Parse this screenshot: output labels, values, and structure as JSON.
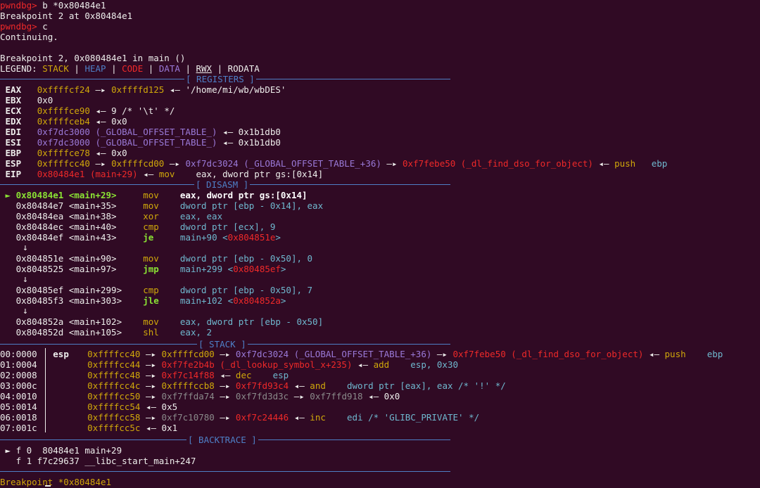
{
  "lines": {
    "l1": {
      "prompt": "pwndbg>",
      "cmd": " b *0x80484e1"
    },
    "l2": "Breakpoint 2 at 0x80484e1",
    "l3": {
      "prompt": "pwndbg>",
      "cmd": " c"
    },
    "l4": "Continuing.",
    "l5": "Breakpoint 2, 0x080484e1 in main ()",
    "legend": {
      "label": "LEGEND: ",
      "stack": "STACK",
      "heap": "HEAP",
      "code": "CODE",
      "data": "DATA",
      "rwx": "RWX",
      "rodata": "RODATA",
      "sep": " | "
    }
  },
  "headers": {
    "registers": "[ REGISTERS ]",
    "disasm": "[ DISASM ]",
    "stack": "[ STACK ]",
    "backtrace": "[ BACKTRACE ]"
  },
  "registers": [
    {
      "name": "EAX",
      "parts": [
        {
          "t": "0xffffcf24",
          "c": "yellow"
        },
        {
          "t": " —▸ ",
          "c": "white"
        },
        {
          "t": "0xffffd125",
          "c": "yellow"
        },
        {
          "t": " ◂— '/home/mi/wb/wbDES'",
          "c": "white"
        }
      ]
    },
    {
      "name": "EBX",
      "parts": [
        {
          "t": "0x0",
          "c": "white"
        }
      ]
    },
    {
      "name": "ECX",
      "parts": [
        {
          "t": "0xffffce90",
          "c": "yellow"
        },
        {
          "t": " ◂— 9 /* '\\t' */",
          "c": "white"
        }
      ]
    },
    {
      "name": "EDX",
      "parts": [
        {
          "t": "0xffffceb4",
          "c": "yellow"
        },
        {
          "t": " ◂— 0x0",
          "c": "white"
        }
      ]
    },
    {
      "name": "EDI",
      "parts": [
        {
          "t": "0xf7dc3000 (_GLOBAL_OFFSET_TABLE_)",
          "c": "purple"
        },
        {
          "t": " ◂— 0x1b1db0",
          "c": "white"
        }
      ]
    },
    {
      "name": "ESI",
      "parts": [
        {
          "t": "0xf7dc3000 (_GLOBAL_OFFSET_TABLE_)",
          "c": "purple"
        },
        {
          "t": " ◂— 0x1b1db0",
          "c": "white"
        }
      ]
    },
    {
      "name": "EBP",
      "parts": [
        {
          "t": "0xffffce78",
          "c": "yellow"
        },
        {
          "t": " ◂— 0x0",
          "c": "white"
        }
      ]
    },
    {
      "name": "ESP",
      "parts": [
        {
          "t": "0xffffcc40",
          "c": "yellow"
        },
        {
          "t": " —▸ ",
          "c": "white"
        },
        {
          "t": "0xffffcd00",
          "c": "yellow"
        },
        {
          "t": " —▸ ",
          "c": "white"
        },
        {
          "t": "0xf7dc3024 (_GLOBAL_OFFSET_TABLE_+36)",
          "c": "purple"
        },
        {
          "t": " —▸ ",
          "c": "white"
        },
        {
          "t": "0xf7febe50 (_dl_find_dso_for_object)",
          "c": "red"
        },
        {
          "t": " ◂— ",
          "c": "white"
        },
        {
          "t": "push",
          "c": "yellow"
        },
        {
          "t": "   ",
          "c": "white"
        },
        {
          "t": "ebp",
          "c": "cyan"
        }
      ]
    },
    {
      "name": "EIP",
      "parts": [
        {
          "t": "0x80484e1 (main+29)",
          "c": "red"
        },
        {
          "t": " ◂— ",
          "c": "white"
        },
        {
          "t": "mov",
          "c": "yellow"
        },
        {
          "t": "    eax, dword ptr gs:[0x14]",
          "c": "white"
        }
      ]
    }
  ],
  "disasm": [
    {
      "cur": true,
      "addr": "0x80484e1",
      "sym": "<main+29>",
      "op": "mov",
      "args": "eax, dword ptr gs:[0x14]"
    },
    {
      "addr": "0x80484e7",
      "sym": "<main+35>",
      "op": "mov",
      "args": "dword ptr [ebp - 0x14], eax"
    },
    {
      "addr": "0x80484ea",
      "sym": "<main+38>",
      "op": "xor",
      "args": "eax, eax"
    },
    {
      "addr": "0x80484ec",
      "sym": "<main+40>",
      "op": "cmp",
      "args": "dword ptr [ecx], 9"
    },
    {
      "addr": "0x80484ef",
      "sym": "<main+43>",
      "op": "je",
      "jmp": true,
      "args": "main+90",
      "target": "0x804851e"
    },
    {
      "addr": "0x804851e",
      "sym": "<main+90>",
      "op": "mov",
      "args": "dword ptr [ebp - 0x50], 0"
    },
    {
      "addr": "0x8048525",
      "sym": "<main+97>",
      "op": "jmp",
      "jmp": true,
      "args": "main+299",
      "target": "0x80485ef"
    },
    {
      "addr": "0x80485ef",
      "sym": "<main+299>",
      "op": "cmp",
      "args": "dword ptr [ebp - 0x50], 7"
    },
    {
      "addr": "0x80485f3",
      "sym": "<main+303>",
      "op": "jle",
      "jmp": true,
      "args": "main+102",
      "target": "0x804852a"
    },
    {
      "addr": "0x804852a",
      "sym": "<main+102>",
      "op": "mov",
      "args": "eax, dword ptr [ebp - 0x50]"
    },
    {
      "addr": "0x804852d",
      "sym": "<main+105>",
      "op": "shl",
      "args": "eax, 2"
    }
  ],
  "stack": [
    {
      "off": "00:0000",
      "reg": "esp",
      "parts": [
        {
          "t": "0xffffcc40",
          "c": "yellow"
        },
        {
          "t": " —▸ ",
          "c": "white"
        },
        {
          "t": "0xffffcd00",
          "c": "yellow"
        },
        {
          "t": " —▸ ",
          "c": "white"
        },
        {
          "t": "0xf7dc3024 (_GLOBAL_OFFSET_TABLE_+36)",
          "c": "purple"
        },
        {
          "t": " —▸ ",
          "c": "white"
        },
        {
          "t": "0xf7febe50 (_dl_find_dso_for_object)",
          "c": "red"
        },
        {
          "t": " ◂— ",
          "c": "white"
        },
        {
          "t": "push",
          "c": "yellow"
        },
        {
          "t": "    ",
          "c": "white"
        },
        {
          "t": "ebp",
          "c": "cyan"
        }
      ]
    },
    {
      "off": "01:0004",
      "reg": "",
      "parts": [
        {
          "t": "0xffffcc44",
          "c": "yellow"
        },
        {
          "t": " —▸ ",
          "c": "white"
        },
        {
          "t": "0xf7fe2b4b (_dl_lookup_symbol_x+235)",
          "c": "red"
        },
        {
          "t": " ◂— ",
          "c": "white"
        },
        {
          "t": "add",
          "c": "yellow"
        },
        {
          "t": "    esp, 0x30",
          "c": "cyan"
        }
      ]
    },
    {
      "off": "02:0008",
      "reg": "",
      "parts": [
        {
          "t": "0xffffcc48",
          "c": "yellow"
        },
        {
          "t": " —▸ ",
          "c": "white"
        },
        {
          "t": "0xf7c14f88",
          "c": "red"
        },
        {
          "t": " ◂— ",
          "c": "white"
        },
        {
          "t": "dec",
          "c": "yellow"
        },
        {
          "t": "    esp",
          "c": "cyan"
        }
      ]
    },
    {
      "off": "03:000c",
      "reg": "",
      "parts": [
        {
          "t": "0xffffcc4c",
          "c": "yellow"
        },
        {
          "t": " —▸ ",
          "c": "white"
        },
        {
          "t": "0xffffccb8",
          "c": "yellow"
        },
        {
          "t": " —▸ ",
          "c": "white"
        },
        {
          "t": "0xf7fd93c4",
          "c": "red"
        },
        {
          "t": " ◂— ",
          "c": "white"
        },
        {
          "t": "and",
          "c": "yellow"
        },
        {
          "t": "    dword ptr [eax], eax /* '!' */",
          "c": "cyan"
        }
      ]
    },
    {
      "off": "04:0010",
      "reg": "",
      "parts": [
        {
          "t": "0xffffcc50",
          "c": "yellow"
        },
        {
          "t": " —▸ ",
          "c": "white"
        },
        {
          "t": "0xf7ffda74",
          "c": "gray"
        },
        {
          "t": " —▸ ",
          "c": "white"
        },
        {
          "t": "0xf7fd3d3c",
          "c": "gray"
        },
        {
          "t": " —▸ ",
          "c": "white"
        },
        {
          "t": "0xf7ffd918",
          "c": "gray"
        },
        {
          "t": " ◂— 0x0",
          "c": "white"
        }
      ]
    },
    {
      "off": "05:0014",
      "reg": "",
      "parts": [
        {
          "t": "0xffffcc54",
          "c": "yellow"
        },
        {
          "t": " ◂— 0x5",
          "c": "white"
        }
      ]
    },
    {
      "off": "06:0018",
      "reg": "",
      "parts": [
        {
          "t": "0xffffcc58",
          "c": "yellow"
        },
        {
          "t": " —▸ ",
          "c": "white"
        },
        {
          "t": "0xf7c10780",
          "c": "gray"
        },
        {
          "t": " —▸ ",
          "c": "white"
        },
        {
          "t": "0xf7c24446",
          "c": "red"
        },
        {
          "t": " ◂— ",
          "c": "white"
        },
        {
          "t": "inc",
          "c": "yellow"
        },
        {
          "t": "    edi /* 'GLIBC_PRIVATE' */",
          "c": "cyan"
        }
      ]
    },
    {
      "off": "07:001c",
      "reg": "",
      "parts": [
        {
          "t": "0xffffcc5c",
          "c": "yellow"
        },
        {
          "t": " ◂— 0x1",
          "c": "white"
        }
      ]
    }
  ],
  "backtrace": [
    {
      "cur": true,
      "text": "f 0  80484e1 main+29"
    },
    {
      "cur": false,
      "text": "f 1 f7c29637 __libc_start_main+247"
    }
  ],
  "footer": {
    "prompt": "Breakpoint *0x80484e1"
  }
}
